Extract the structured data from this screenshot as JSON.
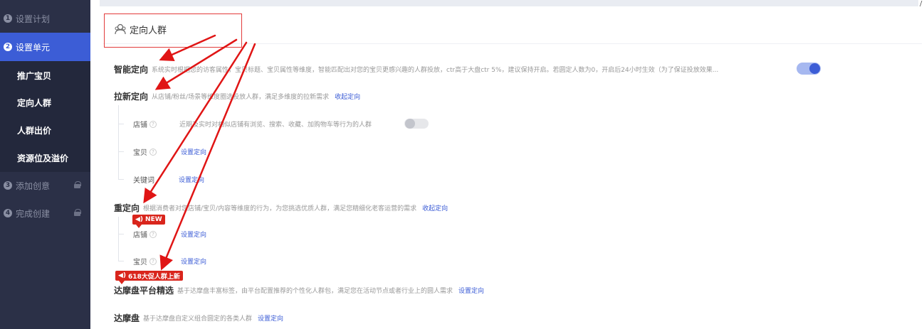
{
  "sidebar": {
    "steps": [
      {
        "num": "1",
        "label": "设置计划"
      },
      {
        "num": "2",
        "label": "设置单元"
      },
      {
        "num": "3",
        "label": "添加创意"
      },
      {
        "num": "4",
        "label": "完成创建"
      }
    ],
    "subitems": [
      "推广宝贝",
      "定向人群",
      "人群出价",
      "资源位及溢价"
    ]
  },
  "corner_mark": "/",
  "header": {
    "title": "定向人群"
  },
  "rows": {
    "smart": {
      "title": "智能定向",
      "desc": "系统实时根据您的访客属性，宝贝标题、宝贝属性等维度，智能匹配出对您的宝贝更感兴趣的人群投放，ctr高于大盘ctr 5%，建议保持开启。若圆定人数为0，开启后24小时生效（为了保证投放效果..."
    },
    "acquire": {
      "title": "拉新定向",
      "desc": "从店铺/粉丝/场景等维度圈选投放人群，满足多维度的拉新需求",
      "link": "收起定向",
      "subs": [
        {
          "label": "店铺",
          "help": "?",
          "desc": "近期及实时对相似店铺有浏览、搜索、收藏、加购物车等行为的人群"
        },
        {
          "label": "宝贝",
          "help": "?",
          "link": "设置定向"
        },
        {
          "label": "关键词",
          "link": "设置定向"
        }
      ]
    },
    "retarget": {
      "title": "重定向",
      "desc": "根据消费者对您店铺/宝贝/内容等维度的行为，为您挑选优质人群，满足您精细化老客运营的需求",
      "link": "收起定向",
      "subs": [
        {
          "label": "店铺",
          "help": "?",
          "link": "设置定向"
        },
        {
          "label": "宝贝",
          "help": "?",
          "link": "设置定向"
        }
      ]
    },
    "damopan_select": {
      "title": "达摩盘平台精选",
      "desc": "基于达摩盘丰富标签，由平台配置推荐的个性化人群包，满足您在活动节点或者行业上的圆人需求",
      "link": "设置定向"
    },
    "damopan": {
      "title": "达摩盘",
      "desc": "基于达摩盘自定义组合圆定的各类人群",
      "link": "设置定向"
    }
  },
  "badges": {
    "new": "NEW",
    "promo": "618大促人群上新"
  },
  "toggles": {
    "smart": true,
    "acquire_shop": false
  },
  "colors": {
    "sidebar_bg": "#2b3047",
    "accent": "#3c5dd6",
    "annotation_red": "#e23b3b"
  }
}
